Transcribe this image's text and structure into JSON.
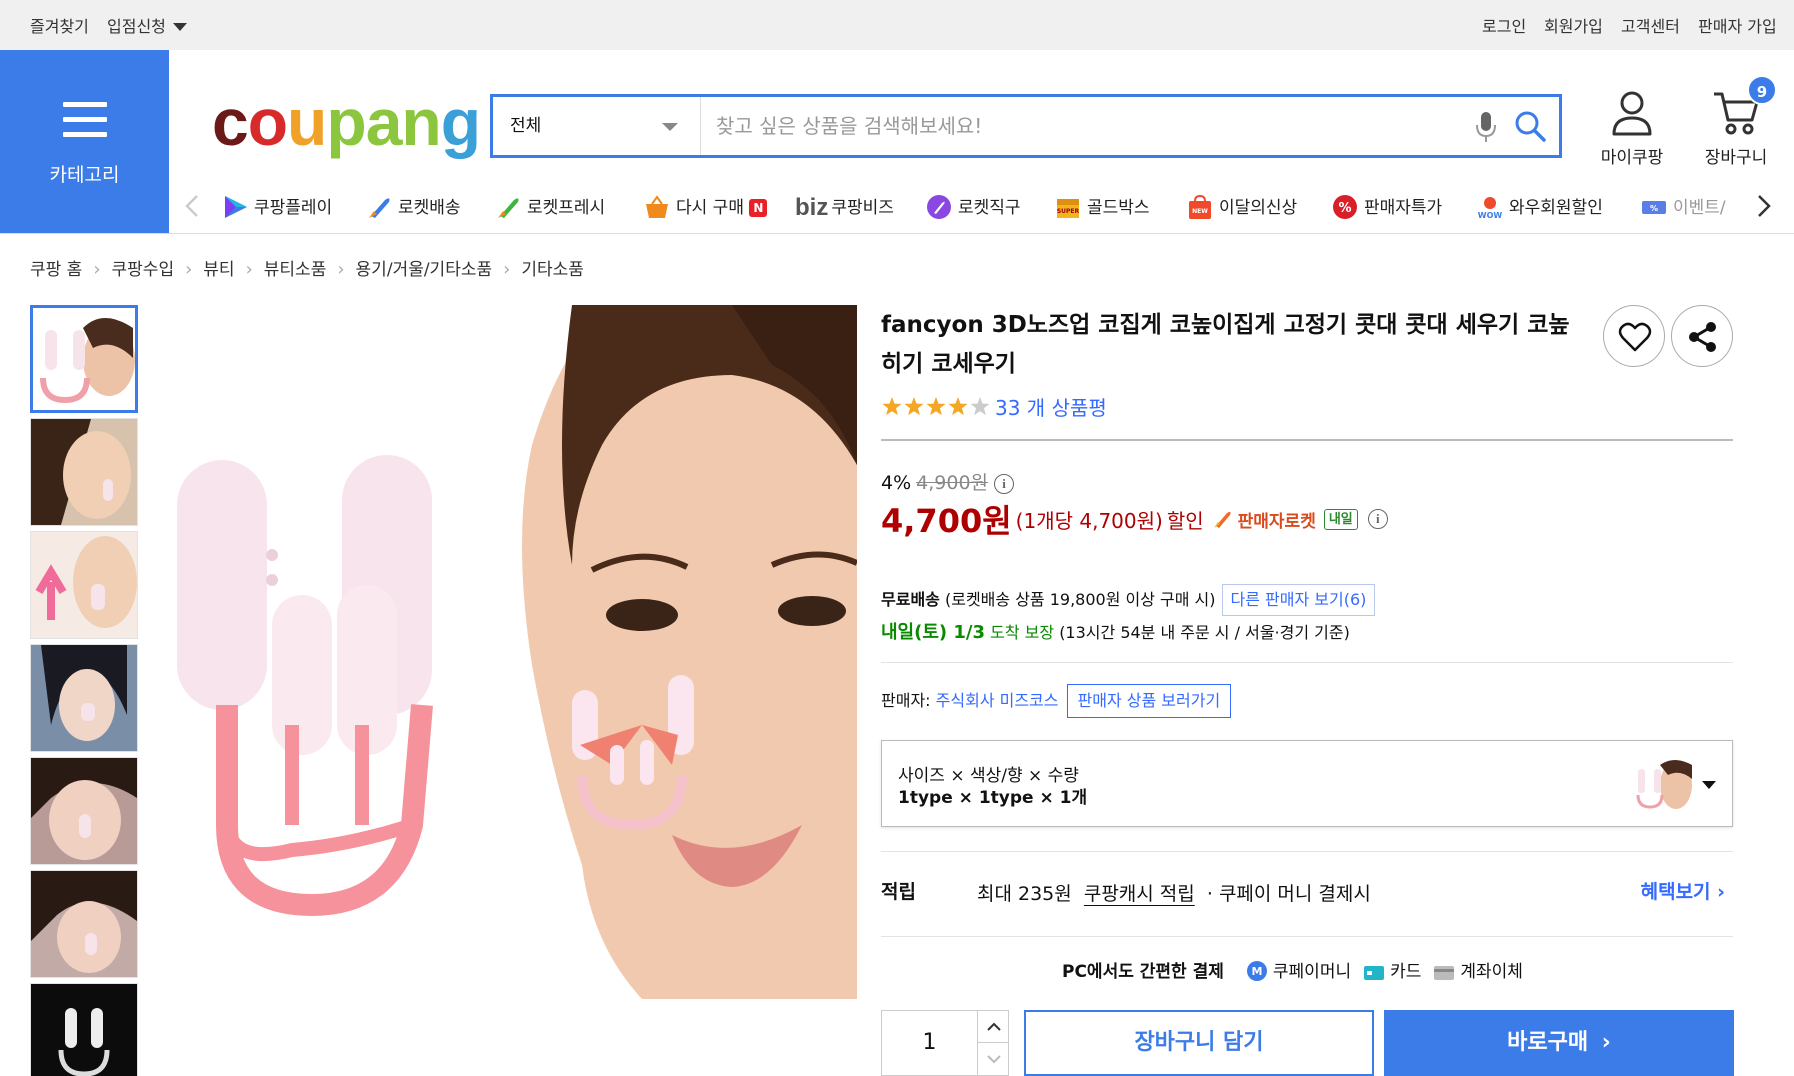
{
  "topbar": {
    "bookmark": "즐겨찾기",
    "join_store": "입점신청",
    "login": "로그인",
    "signup": "회원가입",
    "customer_center": "고객센터",
    "seller_join": "판매자 가입"
  },
  "header": {
    "category_label": "카테고리",
    "logo_parts": [
      "c",
      "o",
      "u",
      "pan",
      "g"
    ],
    "search_scope": "전체",
    "search_placeholder": "찾고 싶은 상품을 검색해보세요!",
    "mycoupang_label": "마이쿠팡",
    "cart_label": "장바구니",
    "cart_count": "9",
    "accent_color": "#3c7ce8"
  },
  "subnav": [
    {
      "label": "쿠팡플레이",
      "icon": "play-icon"
    },
    {
      "label": "로켓배송",
      "icon": "rocket-icon"
    },
    {
      "label": "로켓프레시",
      "icon": "rocket-fresh-icon"
    },
    {
      "label": "다시 구매",
      "icon": "basket-icon"
    },
    {
      "label": "쿠팡비즈",
      "icon": "biz-icon"
    },
    {
      "label": "로켓직구",
      "icon": "rocket-direct-icon"
    },
    {
      "label": "골드박스",
      "icon": "gold-box-icon"
    },
    {
      "label": "이달의신상",
      "icon": "new-bag-icon"
    },
    {
      "label": "판매자특가",
      "icon": "percent-badge-icon"
    },
    {
      "label": "와우회원할인",
      "icon": "wow-icon"
    },
    {
      "label": "이벤트/",
      "icon": "event-icon"
    }
  ],
  "subnav_badge_n": "N",
  "subnav_biz_prefix": "biz",
  "breadcrumb": [
    "쿠팡 홈",
    "쿠팡수입",
    "뷰티",
    "뷰티소품",
    "용기/거울/기타소품",
    "기타소품"
  ],
  "product": {
    "title": "fancyon 3D노즈업 코집게 코높이집게 고정기 콧대 콧대 세우기 코높히기 코세우기",
    "rating": 4,
    "rating_max": 5,
    "review_count_text": "33 개 상품평",
    "discount_rate": "4%",
    "original_price": "4,900원",
    "sale_price": "4,700원",
    "unit_price": "(1개당 4,700원)",
    "discount_label": "할인",
    "seller_rocket": "판매자로켓",
    "tomorrow_badge": "내일",
    "shipping": {
      "free": "무료배송",
      "condition": "(로켓배송 상품 19,800원 이상 구매 시)",
      "other_sellers": "다른 판매자 보기(6)",
      "arrival_date": "내일(토) 1/3",
      "arrival_guarantee": "도착 보장",
      "arrival_condition": "(13시간 54분 내 주문 시 / 서울·경기 기준)"
    },
    "seller_label": "판매자:",
    "seller_name": "주식회사 미즈코스",
    "seller_products_button": "판매자 상품 보러가기",
    "option_header": "사이즈 × 색상/향 × 수량",
    "option_value": "1type × 1type × 1개",
    "reward_label": "적립",
    "reward_text_prefix": "최대 235원",
    "reward_cash": "쿠팡캐시 적립",
    "reward_text_suffix": "· 쿠페이 머니 결제시",
    "reward_more": "혜택보기",
    "pay_title": "PC에서도 간편한 결제",
    "pay_methods": [
      "쿠페이머니",
      "카드",
      "계좌이체"
    ],
    "quantity": "1",
    "add_to_cart": "장바구니 담기",
    "buy_now": "바로구매",
    "price_color": "#ae0000",
    "link_color": "#346aff"
  }
}
